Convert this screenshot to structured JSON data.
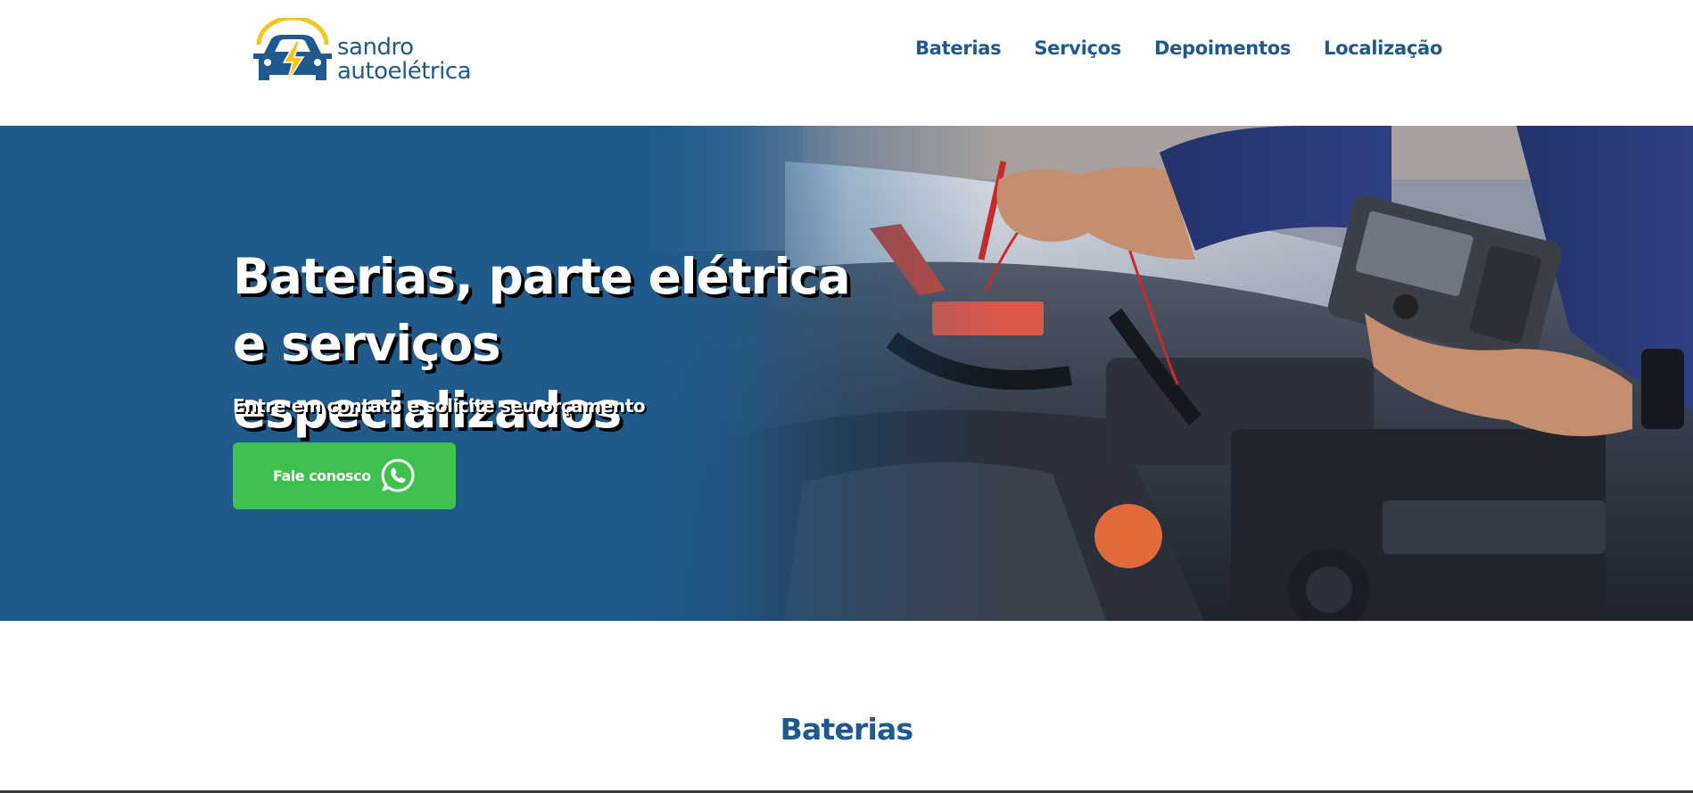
{
  "brand": {
    "name_line1": "sandro",
    "name_line2": "autoelétrica",
    "primary_color": "#1e5a8e",
    "accent_color": "#f5c518"
  },
  "nav": {
    "items": [
      {
        "label": "Baterias"
      },
      {
        "label": "Serviços"
      },
      {
        "label": "Depoimentos"
      },
      {
        "label": "Localização"
      }
    ]
  },
  "hero": {
    "title": "Baterias, parte elétrica e serviços especializados",
    "subtitle": "Entre em contato e solicite seu orçamento",
    "cta_label": "Fale conosco",
    "cta_icon": "whatsapp-icon",
    "cta_color": "#3fc150",
    "background_color": "#1f5a8b",
    "background_image": "mechanic-testing-car-battery-with-multimeter"
  },
  "section": {
    "title": "Baterias"
  }
}
